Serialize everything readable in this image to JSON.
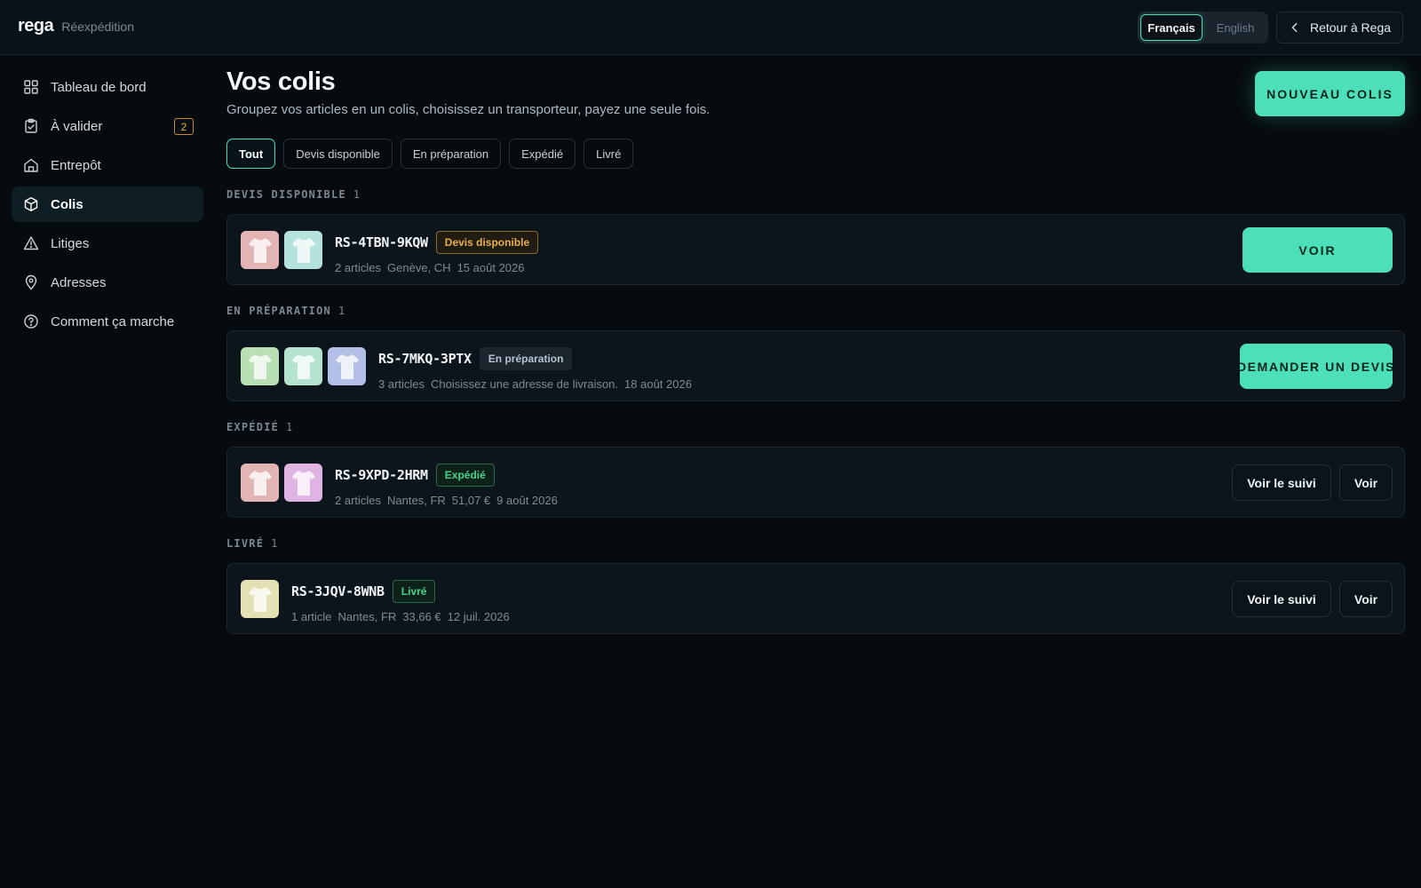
{
  "brand": {
    "logo": "rega",
    "subtitle": "Réexpédition"
  },
  "header": {
    "languages": [
      {
        "label": "Français",
        "active": true
      },
      {
        "label": "English",
        "active": false
      }
    ],
    "back_label": "Retour à Rega"
  },
  "sidebar": {
    "items": [
      {
        "label": "Tableau de bord",
        "icon": "grid-icon"
      },
      {
        "label": "À valider",
        "icon": "clipboard-check-icon",
        "badge": "2"
      },
      {
        "label": "Entrepôt",
        "icon": "warehouse-icon"
      },
      {
        "label": "Colis",
        "icon": "box-icon",
        "active": true
      },
      {
        "label": "Litiges",
        "icon": "warning-triangle-icon"
      },
      {
        "label": "Adresses",
        "icon": "map-pin-icon"
      },
      {
        "label": "Comment ça marche",
        "icon": "help-circle-icon"
      }
    ]
  },
  "main": {
    "title": "Vos colis",
    "subtitle": "Groupez vos articles en un colis, choisissez un transporteur, payez une seule fois.",
    "new_button": "NOUVEAU COLIS",
    "filters": [
      "Tout",
      "Devis disponible",
      "En préparation",
      "Expédié",
      "Livré"
    ],
    "active_filter": "Tout",
    "sections": [
      {
        "label": "DEVIS DISPONIBLE",
        "count": "1",
        "card": {
          "id": "RS-4TBN-9KQW",
          "status": "Devis disponible",
          "meta": [
            "2 articles",
            "Genève, CH",
            "15 août 2026"
          ],
          "thumb_colors": [
            "#e2b4b4",
            "#b3e3dc"
          ],
          "primary_button": "VOIR"
        }
      },
      {
        "label": "EN PRÉPARATION",
        "count": "1",
        "card": {
          "id": "RS-7MKQ-3PTX",
          "status": "En préparation",
          "meta": [
            "3 articles",
            "Choisissez une adresse de livraison.",
            "18 août 2026"
          ],
          "thumb_colors": [
            "#b8e0b4",
            "#b4e3cf",
            "#b3bfe6"
          ],
          "primary_button": "DEMANDER UN DEVIS"
        }
      },
      {
        "label": "EXPÉDIÉ",
        "count": "1",
        "card": {
          "id": "RS-9XPD-2HRM",
          "status": "Expédié",
          "meta": [
            "2 articles",
            "Nantes, FR",
            "51,07 €",
            "9 août 2026"
          ],
          "thumb_colors": [
            "#e2b4b4",
            "#dfb4e3"
          ],
          "tracking_button": "Voir le suivi",
          "view_button": "Voir"
        }
      },
      {
        "label": "LIVRÉ",
        "count": "1",
        "card": {
          "id": "RS-3JQV-8WNB",
          "status": "Livré",
          "meta": [
            "1 article",
            "Nantes, FR",
            "33,66 €",
            "12 juil. 2026"
          ],
          "thumb_colors": [
            "#e3e0b4"
          ],
          "tracking_button": "Voir le suivi",
          "view_button": "Voir"
        }
      }
    ]
  },
  "colors": {
    "accent": "#4de0b8",
    "background": "#060b10",
    "warning": "#e8b04b",
    "success": "#48d48f"
  }
}
